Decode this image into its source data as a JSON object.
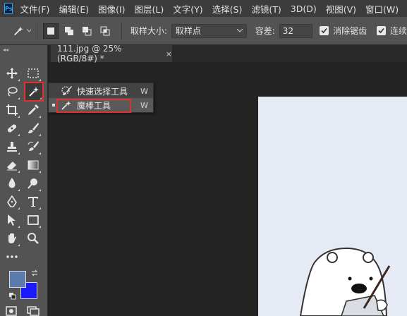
{
  "app": {
    "logo": "Ps"
  },
  "menu": [
    "文件(F)",
    "编辑(E)",
    "图像(I)",
    "图层(L)",
    "文字(Y)",
    "选择(S)",
    "滤镜(T)",
    "3D(D)",
    "视图(V)",
    "窗口(W)"
  ],
  "options": {
    "sample_size_label": "取样大小:",
    "sample_size_value": "取样点",
    "tolerance_label": "容差:",
    "tolerance_value": "32",
    "antialias_label": "消除锯齿",
    "contiguous_label": "连续"
  },
  "tab": {
    "title": "111.jpg @ 25%(RGB/8#) *",
    "close": "×"
  },
  "flyout": {
    "items": [
      {
        "label": "快速选择工具",
        "shortcut": "W",
        "icon": "quick-selection-icon"
      },
      {
        "label": "魔棒工具",
        "shortcut": "W",
        "icon": "magic-wand-icon"
      }
    ]
  },
  "colors": {
    "foreground": "#5d7aad",
    "background": "#1a1aff",
    "highlight": "#e03030"
  },
  "toolbar": {
    "collapse": "◂◂"
  }
}
